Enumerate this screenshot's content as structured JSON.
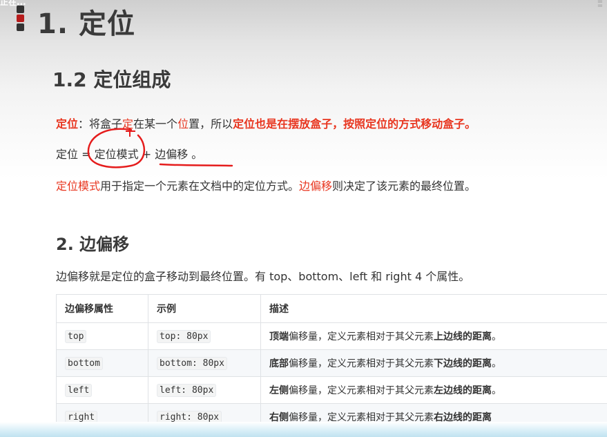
{
  "corner": "正在...",
  "h1": "1. 定位",
  "h2_composition": "1.2 定位组成",
  "line1": {
    "term": "定位",
    "sep": "：将盒子",
    "r1": "定",
    "t2": "在某一个",
    "r2": "位",
    "t3": "置，所以",
    "emph": "定位也是在摆放盒子，按照定位的方式移动盒子。"
  },
  "line2": {
    "left": "定位 = ",
    "mode": "定位模式",
    "plus": " + ",
    "offset": "边偏移",
    "end": " 。"
  },
  "line3": {
    "mode": "定位模式",
    "t1": "用于指定一个元素在文档中的定位方式。",
    "offset": "边偏移",
    "t2": "则决定了该元素的最终位置。"
  },
  "h2_offset": "2. 边偏移",
  "intro": "边偏移就是定位的盒子移动到最终位置。有 top、bottom、left 和 right  4 个属性。",
  "table": {
    "headers": [
      "边偏移属性",
      "示例",
      "描述"
    ],
    "rows": [
      {
        "prop": "top",
        "example": "top: 80px",
        "d_bold": "顶端",
        "d_mid": "偏移量，定义元素相对于其父元素",
        "d_bold2": "上边线的距离",
        "d_end": "。"
      },
      {
        "prop": "bottom",
        "example": "bottom: 80px",
        "d_bold": "底部",
        "d_mid": "偏移量，定义元素相对于其父元素",
        "d_bold2": "下边线的距离",
        "d_end": "。"
      },
      {
        "prop": "left",
        "example": "left: 80px",
        "d_bold": "左侧",
        "d_mid": "偏移量，定义元素相对于其父元素",
        "d_bold2": "左边线的距离",
        "d_end": "。"
      },
      {
        "prop": "right",
        "example": "right: 80px",
        "d_bold": "右侧",
        "d_mid": "偏移量，定义元素相对于其父元素",
        "d_bold2": "右边线的距离",
        "d_end": ""
      }
    ]
  }
}
